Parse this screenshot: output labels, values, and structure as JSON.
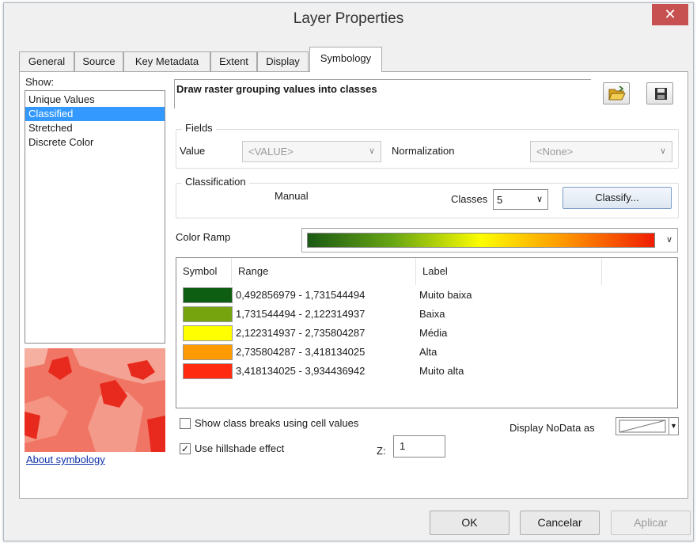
{
  "window": {
    "title": "Layer Properties",
    "close_glyph": "✕"
  },
  "tabs": [
    {
      "label": "General"
    },
    {
      "label": "Source"
    },
    {
      "label": "Key Metadata"
    },
    {
      "label": "Extent"
    },
    {
      "label": "Display"
    },
    {
      "label": "Symbology",
      "active": true
    }
  ],
  "show": {
    "label": "Show:",
    "items": [
      {
        "label": "Unique Values"
      },
      {
        "label": "Classified",
        "selected": true
      },
      {
        "label": "Stretched"
      },
      {
        "label": "Discrete Color"
      }
    ]
  },
  "about_link": "About symbology",
  "description": "Draw raster grouping values into classes",
  "icons": {
    "open": "folder-open-icon",
    "save": "floppy-disk-icon"
  },
  "fields": {
    "legend": "Fields",
    "value_label": "Value",
    "value_selected": "<VALUE>",
    "normalization_label": "Normalization",
    "normalization_selected": "<None>"
  },
  "classification": {
    "legend": "Classification",
    "method": "Manual",
    "classes_label": "Classes",
    "classes_value": "5",
    "classify_button": "Classify..."
  },
  "color_ramp": {
    "label": "Color Ramp",
    "colors": [
      "#1a5a14",
      "#6aa714",
      "#fdfd00",
      "#ff9200",
      "#f01d00"
    ]
  },
  "table": {
    "headers": {
      "symbol": "Symbol",
      "range": "Range",
      "label": "Label"
    },
    "rows": [
      {
        "color": "#0d5e12",
        "range": "0,492856979 - 1,731544494",
        "label": "Muito baixa"
      },
      {
        "color": "#76a40e",
        "range": "1,731544494 - 2,122314937",
        "label": "Baixa"
      },
      {
        "color": "#ffff00",
        "range": "2,122314937 - 2,735804287",
        "label": "Média"
      },
      {
        "color": "#ff9a00",
        "range": "2,735804287 - 3,418134025",
        "label": "Alta"
      },
      {
        "color": "#ff2a10",
        "range": "3,418134025 - 3,934436942",
        "label": "Muito alta"
      }
    ]
  },
  "options": {
    "show_breaks": {
      "label": "Show class breaks using cell values",
      "checked": false
    },
    "hillshade": {
      "label": "Use hillshade effect",
      "checked": true
    },
    "z_label": "Z:",
    "z_value": "1",
    "nodata_label": "Display NoData as"
  },
  "footer": {
    "ok": "OK",
    "cancel": "Cancelar",
    "apply": "Aplicar"
  }
}
